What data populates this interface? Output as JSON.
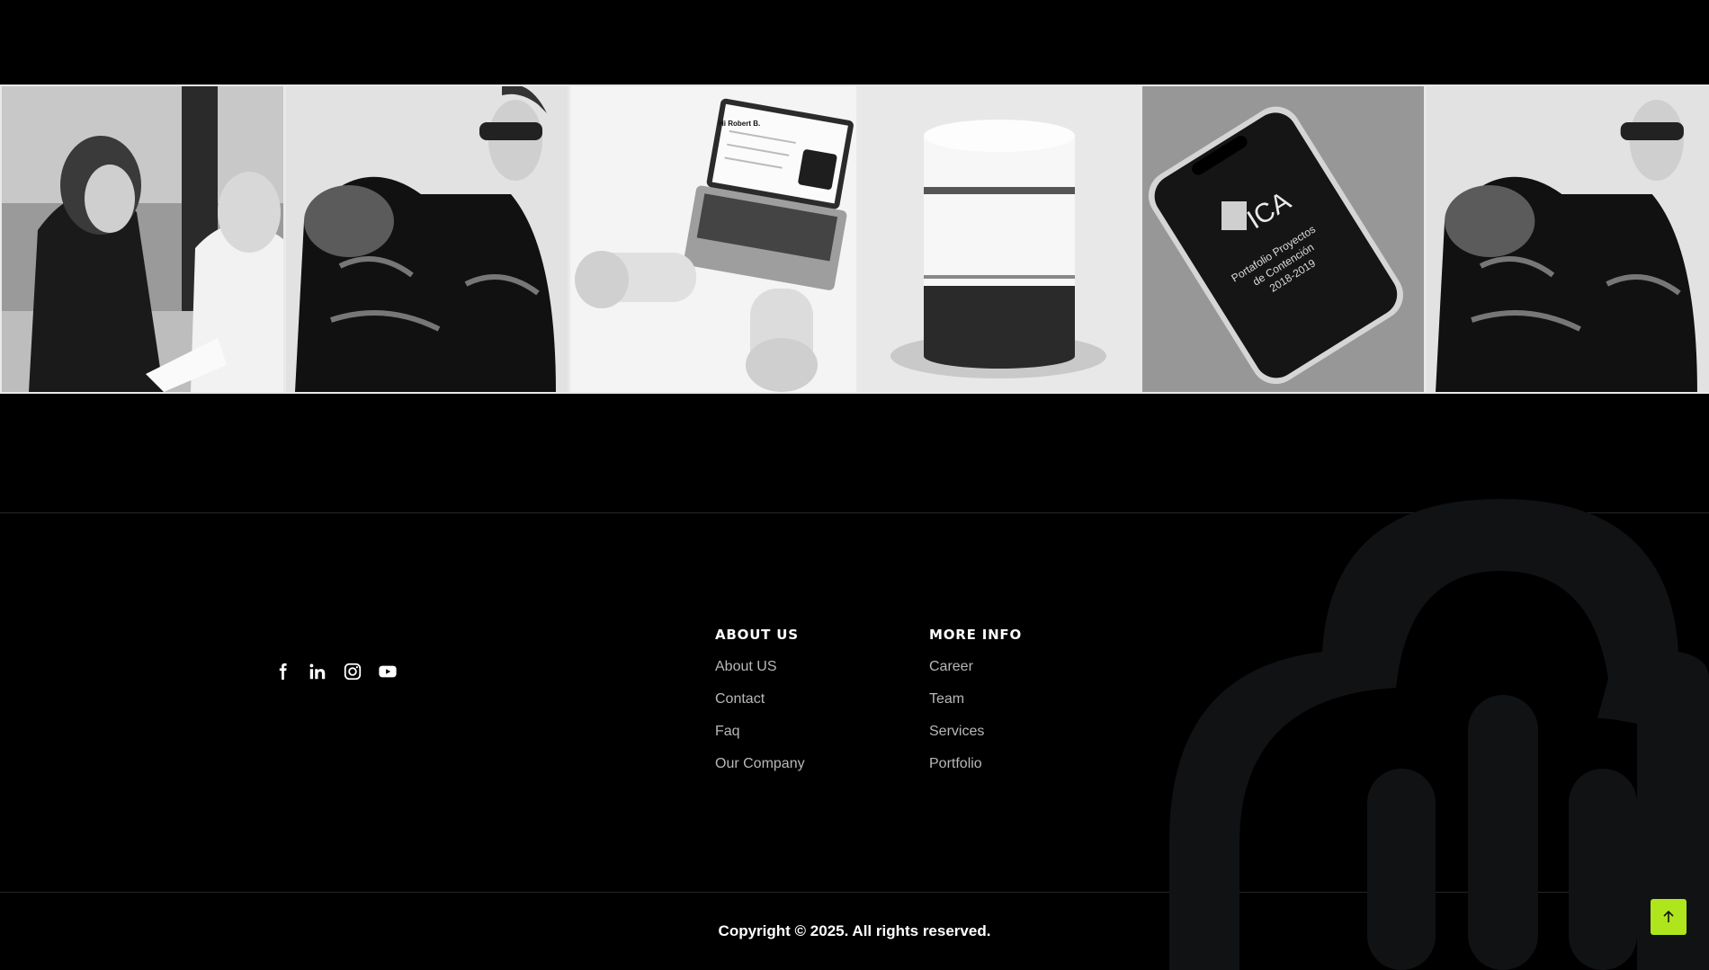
{
  "gallery": {
    "tiles": [
      {
        "image": "two women in a meeting",
        "icon": "photo"
      },
      {
        "image": "person in puffer jacket with sunglasses",
        "icon": "photo"
      },
      {
        "image": "hands typing on laptop",
        "icon": "photo"
      },
      {
        "image": "cylinder product mockup",
        "icon": "photo"
      },
      {
        "image": "phone mockup",
        "icon": "photo"
      },
      {
        "image": "person in puffer jacket with sunglasses",
        "icon": "photo"
      }
    ],
    "laptop_screen_text": "Hi Robert B.",
    "phone_logo_text": "ICA",
    "phone_caption_lines": [
      "Portafolio Proyectos",
      "de Contención",
      "2018-2019"
    ]
  },
  "social": [
    {
      "name": "facebook",
      "icon": "facebook-icon"
    },
    {
      "name": "linkedin",
      "icon": "linkedin-icon"
    },
    {
      "name": "instagram",
      "icon": "instagram-icon"
    },
    {
      "name": "youtube",
      "icon": "youtube-icon"
    }
  ],
  "footer": {
    "about": {
      "heading": "ABOUT US",
      "links": [
        "About US",
        "Contact",
        "Faq",
        "Our Company"
      ]
    },
    "more": {
      "heading": "MORE INFO",
      "links": [
        "Career",
        "Team",
        "Services",
        "Portfolio"
      ]
    },
    "copyright": "Copyright © 2025. All rights reserved."
  },
  "colors": {
    "background": "#000000",
    "accent": "#aee51c",
    "link": "#b8b8b8",
    "brand_mark": "#111214"
  }
}
